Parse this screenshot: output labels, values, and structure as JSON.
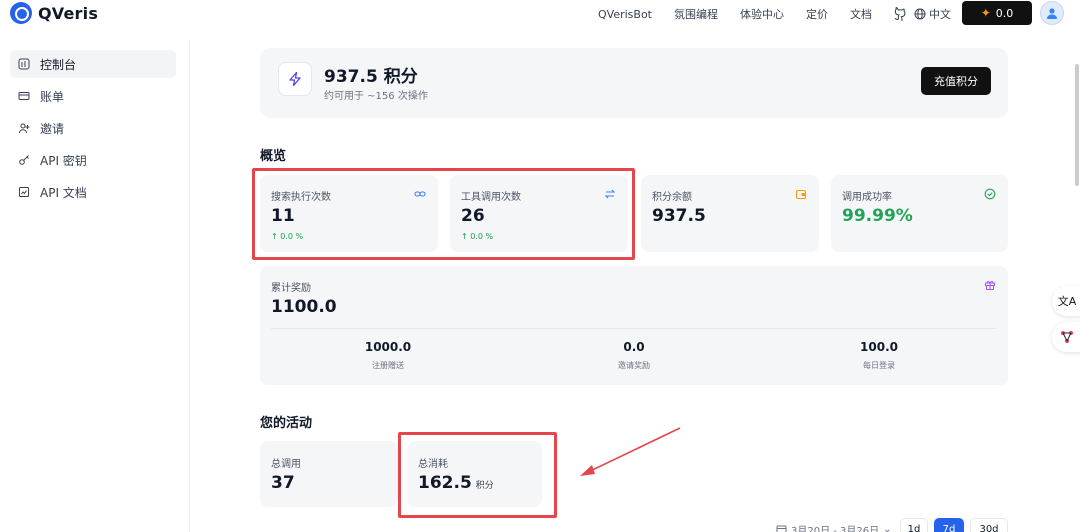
{
  "header": {
    "logo_text": "QVeris",
    "nav": [
      "QVerisBot",
      "氛围编程",
      "体验中心",
      "定价",
      "文档"
    ],
    "language": "中文",
    "credit_display": "0.0"
  },
  "sidebar": {
    "items": [
      {
        "label": "控制台",
        "icon": "dashboard-icon"
      },
      {
        "label": "账单",
        "icon": "card-icon"
      },
      {
        "label": "邀请",
        "icon": "user-plus-icon"
      },
      {
        "label": "API 密钥",
        "icon": "key-icon"
      },
      {
        "label": "API 文档",
        "icon": "doc-icon"
      }
    ]
  },
  "balance": {
    "value": "937.5 积分",
    "subtitle": "约可用于 ~156 次操作",
    "recharge_label": "充值积分"
  },
  "overview": {
    "title": "概览",
    "cards": [
      {
        "label": "搜索执行次数",
        "value": "11",
        "trend": "↑ 0.0 %",
        "icon": "link-icon"
      },
      {
        "label": "工具调用次数",
        "value": "26",
        "trend": "↑ 0.0 %",
        "icon": "swap-icon"
      },
      {
        "label": "积分余额",
        "value": "937.5",
        "icon": "wallet-icon"
      },
      {
        "label": "调用成功率",
        "value": "99.99%",
        "icon": "check-circle-icon"
      }
    ],
    "rewards": {
      "label": "累计奖励",
      "value": "1100.0",
      "icon": "gift-icon",
      "breakdown": [
        {
          "value": "1000.0",
          "label": "注册赠送"
        },
        {
          "value": "0.0",
          "label": "邀请奖励"
        },
        {
          "value": "100.0",
          "label": "每日登录"
        }
      ]
    }
  },
  "activity": {
    "title": "您的活动",
    "total_calls_label": "总调用",
    "total_calls_value": "37",
    "total_spent_label": "总消耗",
    "total_spent_value": "162.5",
    "total_spent_unit": "积分",
    "date_range": "3月20日 - 3月26日",
    "ranges": [
      "1d",
      "7d",
      "30d"
    ],
    "active_range": "7d"
  },
  "colors": {
    "accent": "#2563eb",
    "success": "#22a355",
    "highlight": "#e4474b",
    "dark_button": "#111111"
  }
}
